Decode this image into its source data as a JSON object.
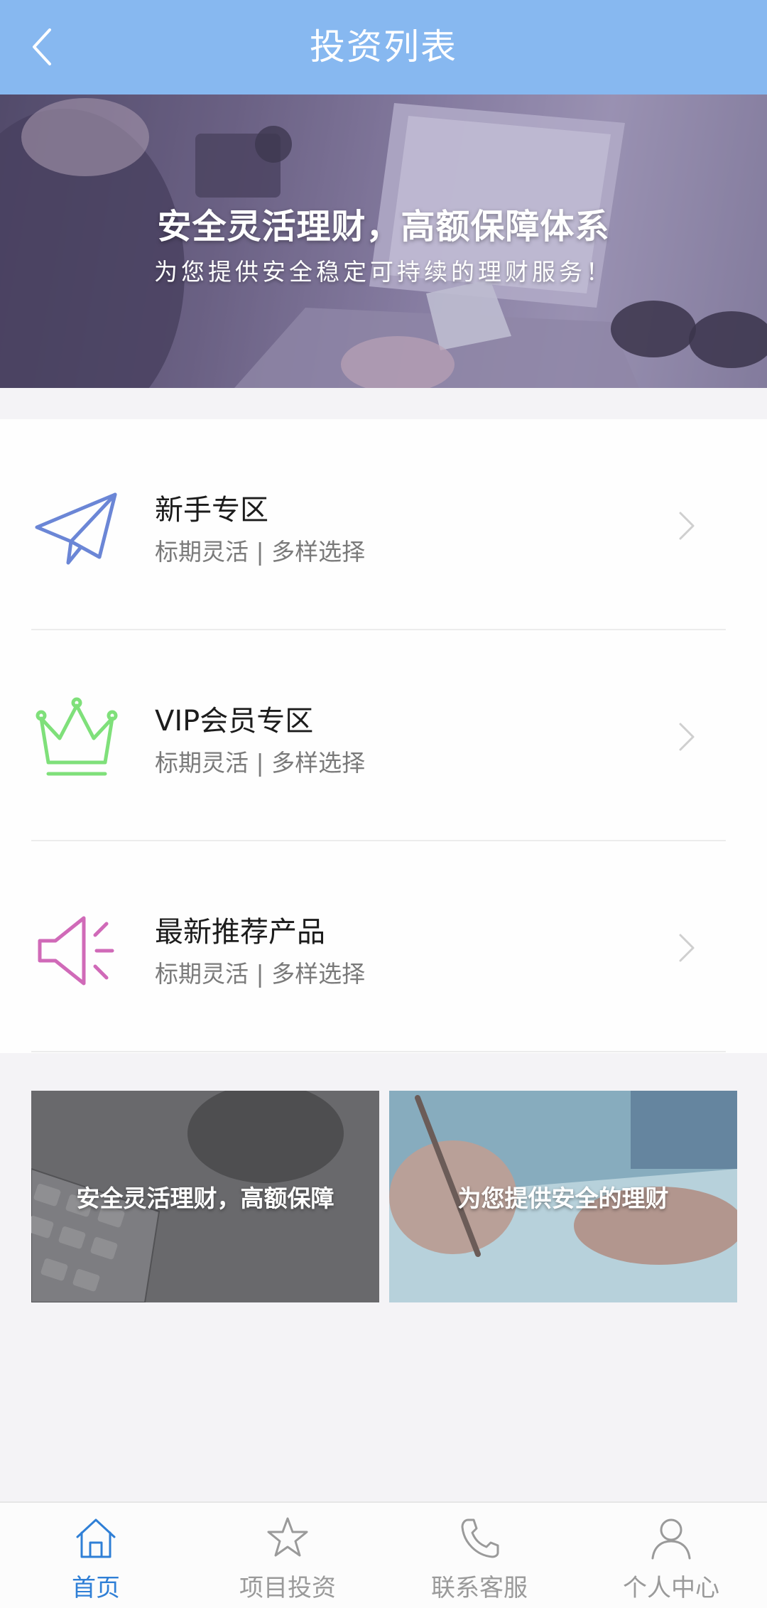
{
  "header": {
    "title": "投资列表",
    "back_icon": "chevron-left-icon"
  },
  "hero": {
    "headline": "安全灵活理财，高额保障体系",
    "subtitle": "为您提供安全稳定可持续的理财服务！"
  },
  "menu": {
    "items": [
      {
        "title": "新手专区",
        "desc": "标期灵活 | 多样选择",
        "icon": "paper-plane-icon",
        "icon_color": "#6b86d6"
      },
      {
        "title": "VIP会员专区",
        "desc": "标期灵活 | 多样选择",
        "icon": "crown-icon",
        "icon_color": "#7fe07a"
      },
      {
        "title": "最新推荐产品",
        "desc": "标期灵活 | 多样选择",
        "icon": "speaker-icon",
        "icon_color": "#d06ab8"
      }
    ]
  },
  "promos": [
    {
      "caption": "安全灵活理财，高额保障"
    },
    {
      "caption": "为您提供安全的理财"
    }
  ],
  "tabbar": {
    "active_color": "#2f7fd6",
    "tabs": [
      {
        "label": "首页",
        "icon": "home-icon",
        "active": true
      },
      {
        "label": "项目投资",
        "icon": "star-icon",
        "active": false
      },
      {
        "label": "联系客服",
        "icon": "phone-icon",
        "active": false
      },
      {
        "label": "个人中心",
        "icon": "person-icon",
        "active": false
      }
    ]
  },
  "colors": {
    "header_bg": "#87b8f0",
    "page_bg": "#f4f3f6"
  }
}
